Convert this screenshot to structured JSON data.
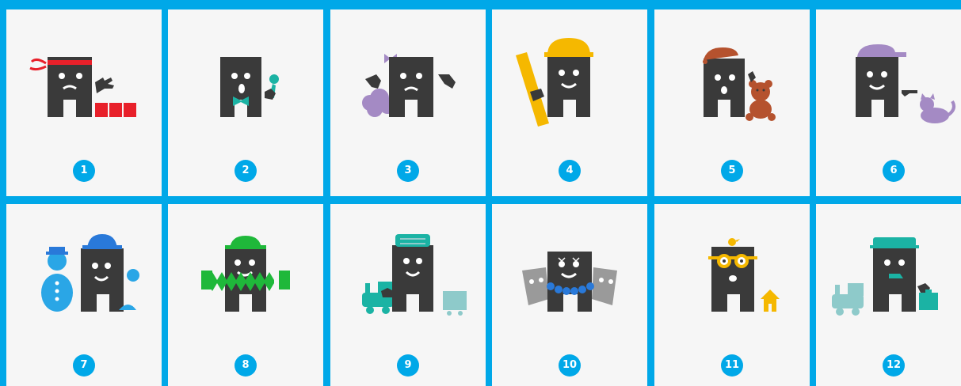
{
  "colors": {
    "background": "#00a8e8",
    "card": "#f6f6f6",
    "character": "#3a3a3a",
    "badge": "#00a8e8",
    "red": "#e8202a",
    "teal": "#1bb3a4",
    "purple": "#a48ac4",
    "yellow": "#f5b800",
    "brown": "#b5522e",
    "green": "#1fb83a",
    "gray": "#9a9a9a",
    "lightTeal": "#8ecaca",
    "blue": "#2979d9"
  },
  "cards": [
    {
      "number": "1",
      "icon": "ninja-character-icon"
    },
    {
      "number": "2",
      "icon": "singer-character-icon"
    },
    {
      "number": "3",
      "icon": "bow-character-icon"
    },
    {
      "number": "4",
      "icon": "builder-character-icon"
    },
    {
      "number": "5",
      "icon": "teddy-character-icon"
    },
    {
      "number": "6",
      "icon": "cat-character-icon"
    },
    {
      "number": "7",
      "icon": "snowman-character-icon"
    },
    {
      "number": "8",
      "icon": "accordion-character-icon"
    },
    {
      "number": "9",
      "icon": "train-driver-character-icon"
    },
    {
      "number": "10",
      "icon": "theater-character-icon"
    },
    {
      "number": "11",
      "icon": "glasses-character-icon"
    },
    {
      "number": "12",
      "icon": "conductor-character-icon"
    }
  ]
}
